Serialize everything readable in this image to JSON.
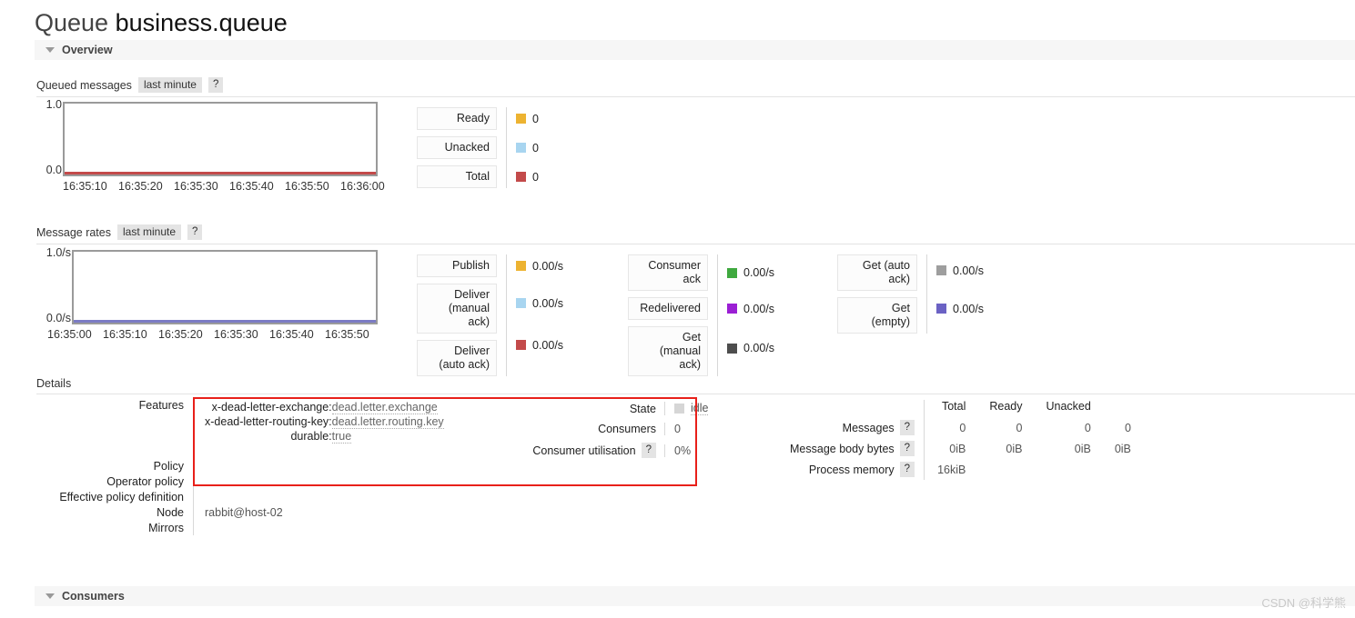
{
  "header": {
    "title_prefix": "Queue",
    "queue_name": "business.queue"
  },
  "sections": {
    "overview": "Overview",
    "consumers": "Consumers"
  },
  "queued_messages": {
    "heading": "Queued messages",
    "period": "last minute",
    "help": "?"
  },
  "message_rates": {
    "heading": "Message rates",
    "period": "last minute",
    "help": "?"
  },
  "details": {
    "heading": "Details",
    "features_label": "Features",
    "policy_label": "Policy",
    "operator_policy_label": "Operator policy",
    "effective_policy_label": "Effective policy definition",
    "node_label": "Node",
    "mirrors_label": "Mirrors",
    "features": [
      {
        "key": "x-dead-letter-exchange:",
        "value": "dead.letter.exchange"
      },
      {
        "key": "x-dead-letter-routing-key:",
        "value": "dead.letter.routing.key"
      },
      {
        "key": "durable:",
        "value": "true"
      }
    ],
    "policy_value": "",
    "operator_policy_value": "",
    "effective_policy_value": "",
    "node_value": "rabbit@host-02",
    "mirrors_value": ""
  },
  "state": {
    "state_label": "State",
    "state_value": "idle",
    "consumers_label": "Consumers",
    "consumers_value": "0",
    "utilisation_label": "Consumer utilisation",
    "utilisation_help": "?",
    "utilisation_value": "0%"
  },
  "messages_stats": {
    "columns": [
      "Total",
      "Ready",
      "Unacked",
      ""
    ],
    "rows": [
      {
        "label": "Messages",
        "help": "?",
        "values": [
          "0",
          "0",
          "0",
          "0"
        ]
      },
      {
        "label": "Message body bytes",
        "help": "?",
        "values": [
          "0iB",
          "0iB",
          "0iB",
          "0iB"
        ]
      },
      {
        "label": "Process memory",
        "help": "?",
        "values": [
          "16kiB",
          "",
          "",
          ""
        ]
      }
    ]
  },
  "watermark": "CSDN @科学熊",
  "chart_data": [
    {
      "type": "line",
      "title": "Queued messages",
      "subtitle": "last minute",
      "x": [
        "16:35:10",
        "16:35:20",
        "16:35:30",
        "16:35:40",
        "16:35:50",
        "16:36:00"
      ],
      "xlabel": "",
      "ylabel": "",
      "ylim": [
        0.0,
        1.0
      ],
      "yticks": [
        "0.0",
        "1.0"
      ],
      "grid": false,
      "legend_position": "right",
      "series": [
        {
          "name": "Ready",
          "color": "#edb331",
          "value": "0",
          "values": [
            0,
            0,
            0,
            0,
            0,
            0
          ]
        },
        {
          "name": "Unacked",
          "color": "#a8d5f0",
          "value": "0",
          "values": [
            0,
            0,
            0,
            0,
            0,
            0
          ]
        },
        {
          "name": "Total",
          "color": "#c34a4a",
          "value": "0",
          "values": [
            0,
            0,
            0,
            0,
            0,
            0
          ]
        }
      ]
    },
    {
      "type": "line",
      "title": "Message rates",
      "subtitle": "last minute",
      "x": [
        "16:35:00",
        "16:35:10",
        "16:35:20",
        "16:35:30",
        "16:35:40",
        "16:35:50"
      ],
      "xlabel": "",
      "ylabel": "",
      "ylim": [
        0.0,
        1.0
      ],
      "yticks": [
        "0.0/s",
        "1.0/s"
      ],
      "grid": false,
      "legend_position": "right",
      "series": [
        {
          "name": "Publish",
          "color": "#edb331",
          "value": "0.00/s",
          "values": [
            0,
            0,
            0,
            0,
            0,
            0
          ]
        },
        {
          "name": "Deliver\n(manual\nack)",
          "color": "#a8d5f0",
          "value": "0.00/s",
          "values": [
            0,
            0,
            0,
            0,
            0,
            0
          ]
        },
        {
          "name": "Deliver\n(auto ack)",
          "color": "#c34a4a",
          "value": "0.00/s",
          "values": [
            0,
            0,
            0,
            0,
            0,
            0
          ]
        },
        {
          "name": "Consumer\nack",
          "color": "#3fa93f",
          "value": "0.00/s",
          "values": [
            0,
            0,
            0,
            0,
            0,
            0
          ]
        },
        {
          "name": "Redelivered",
          "color": "#9b1fd4",
          "value": "0.00/s",
          "values": [
            0,
            0,
            0,
            0,
            0,
            0
          ]
        },
        {
          "name": "Get\n(manual\nack)",
          "color": "#4d4d4d",
          "value": "0.00/s",
          "values": [
            0,
            0,
            0,
            0,
            0,
            0
          ]
        },
        {
          "name": "Get (auto\nack)",
          "color": "#9e9e9e",
          "value": "0.00/s",
          "values": [
            0,
            0,
            0,
            0,
            0,
            0
          ]
        },
        {
          "name": "Get\n(empty)",
          "color": "#6b62c4",
          "value": "0.00/s",
          "values": [
            0,
            0,
            0,
            0,
            0,
            0
          ]
        }
      ]
    }
  ]
}
